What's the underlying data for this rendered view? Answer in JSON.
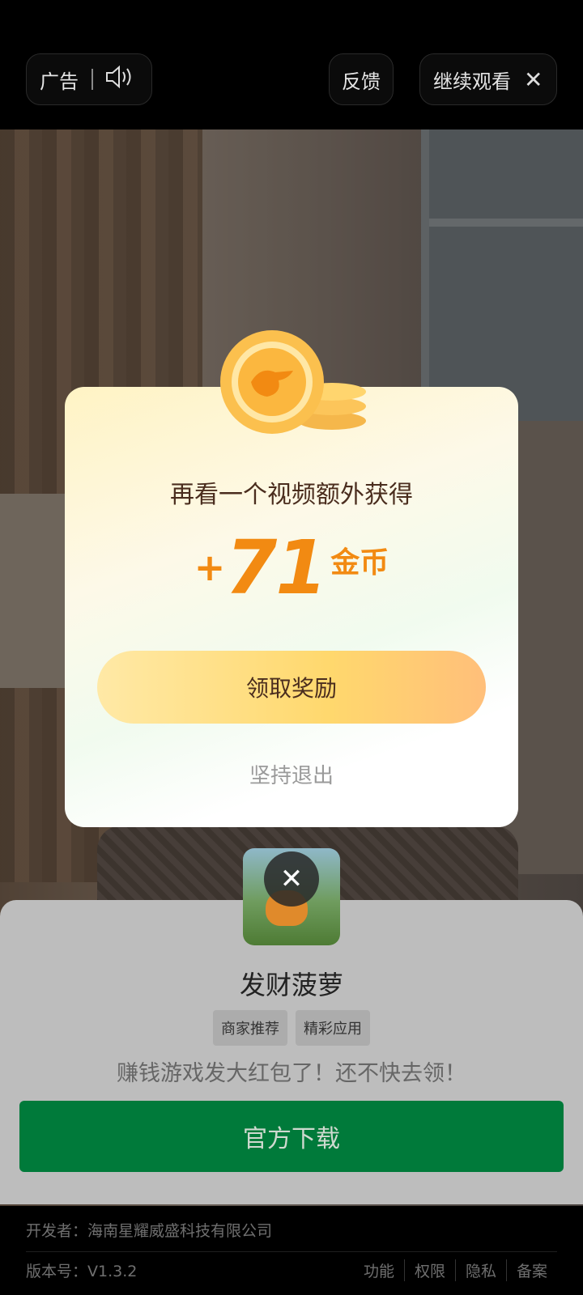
{
  "topbar": {
    "ad_label": "广告",
    "sound_icon": "speaker-icon",
    "feedback_label": "反馈",
    "continue_label": "继续观看",
    "close_icon": "close-icon"
  },
  "modal": {
    "title": "再看一个视频额外获得",
    "plus": "+",
    "amount": "71",
    "unit": "金币",
    "claim_button": "领取奖励",
    "quit_link": "坚持退出",
    "coin_icon": "coin-icon"
  },
  "app_card": {
    "close_icon": "close-icon",
    "name": "发财菠萝",
    "tags": [
      "商家推荐",
      "精彩应用"
    ],
    "slogan": "赚钱游戏发大红包了！还不快去领！",
    "download_button": "官方下载"
  },
  "footer": {
    "developer": "开发者：海南星耀威盛科技有限公司",
    "version": "版本号：V1.3.2",
    "links": [
      "功能",
      "权限",
      "隐私",
      "备案"
    ]
  },
  "colors": {
    "amount": "#f28a12",
    "download_button": "#007a3a",
    "claim_button": "#ffd86d"
  }
}
